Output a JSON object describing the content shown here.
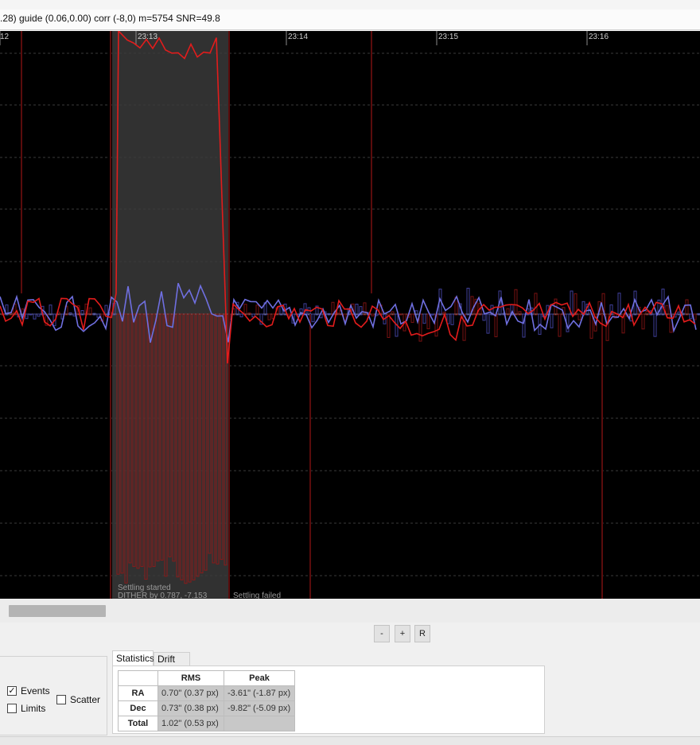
{
  "status_bar": {
    "text": ".28) guide (0.06,0.00) corr (-8,0) m=5754 SNR=49.8"
  },
  "graph": {
    "time_labels": [
      "12",
      "23:13",
      "23:14",
      "23:15",
      "23:16"
    ],
    "event_labels": {
      "settling_started": "Settling started",
      "dither": "DITHER by 0.787, -7.153",
      "settling_failed": "Settling failed"
    },
    "colors": {
      "background": "#000000",
      "ra_line": "#6f6fe0",
      "dec_line": "#e21c1c",
      "correction_bars": "#8a1414",
      "settling_band": "#3a3a3a",
      "grid": "#2a2a2a"
    }
  },
  "zoom_controls": {
    "minus": "-",
    "plus": "+",
    "reset": "R"
  },
  "options": {
    "events_label": "Events",
    "events_checked": true,
    "limits_label": "Limits",
    "limits_checked": false,
    "scatter_label": "Scatter",
    "scatter_checked": false
  },
  "tabs": {
    "statistics": "Statistics",
    "drift": "Drift"
  },
  "stats": {
    "headers": [
      "RMS",
      "Peak"
    ],
    "rows": [
      {
        "label": "RA",
        "rms": "0.70\" (0.37 px)",
        "peak": "-3.61\" (-1.87 px)"
      },
      {
        "label": "Dec",
        "rms": "0.73\" (0.38 px)",
        "peak": "-9.82\" (-5.09 px)"
      },
      {
        "label": "Total",
        "rms": "1.02\" (0.53 px)",
        "peak": ""
      }
    ]
  }
}
